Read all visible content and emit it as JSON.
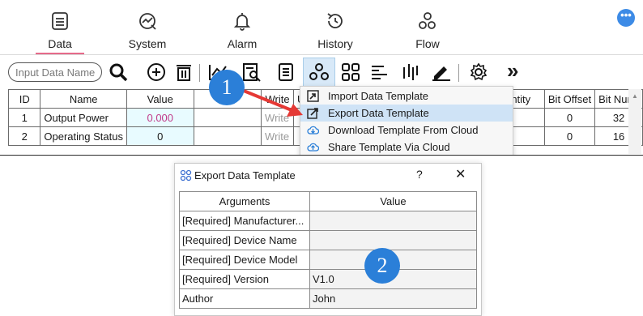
{
  "nav": {
    "tabs": [
      {
        "label": "Data",
        "icon": "data-icon",
        "active": true
      },
      {
        "label": "System",
        "icon": "system-icon"
      },
      {
        "label": "Alarm",
        "icon": "bell-icon"
      },
      {
        "label": "History",
        "icon": "history-icon"
      },
      {
        "label": "Flow",
        "icon": "flow-icon"
      }
    ],
    "more_label": "•••"
  },
  "toolbar": {
    "search_placeholder": "Input Data Name",
    "more_label": "»"
  },
  "table": {
    "headers": [
      "ID",
      "Name",
      "Value",
      "",
      "Write",
      "U"
    ],
    "right_headers": [
      "ntity",
      "Bit Offset",
      "Bit Num."
    ],
    "rows": [
      {
        "id": "1",
        "name": "Output Power",
        "value": "0.000",
        "write": "Write",
        "bit_offset": "0",
        "bit_num": "32"
      },
      {
        "id": "2",
        "name": "Operating Status",
        "value": "0",
        "write": "Write",
        "bit_offset": "0",
        "bit_num": "16"
      }
    ]
  },
  "menu": {
    "items": [
      {
        "label": "Import Data Template",
        "icon": "import-icon"
      },
      {
        "label": "Export Data Template",
        "icon": "export-icon",
        "highlighted": true
      },
      {
        "label": "Download Template From Cloud",
        "icon": "cloud-download-icon"
      },
      {
        "label": "Share Template Via Cloud",
        "icon": "cloud-share-icon"
      }
    ]
  },
  "badges": {
    "step1": "1",
    "step2": "2"
  },
  "dialog": {
    "title": "Export Data Template",
    "help": "?",
    "close": "✕",
    "columns": [
      "Arguments",
      "Value"
    ],
    "rows": [
      {
        "arg": "[Required] Manufacturer...",
        "value": ""
      },
      {
        "arg": "[Required] Device Name",
        "value": ""
      },
      {
        "arg": "[Required] Device Model",
        "value": ""
      },
      {
        "arg": "[Required] Version",
        "value": "V1.0"
      },
      {
        "arg": "Author",
        "value": "John"
      }
    ]
  },
  "colors": {
    "accent": "#2b7fd8",
    "active_underline": "#e66a8a",
    "value_text": "#c0398a",
    "menu_highlight": "#cfe3f6",
    "arrow": "#e53935"
  }
}
